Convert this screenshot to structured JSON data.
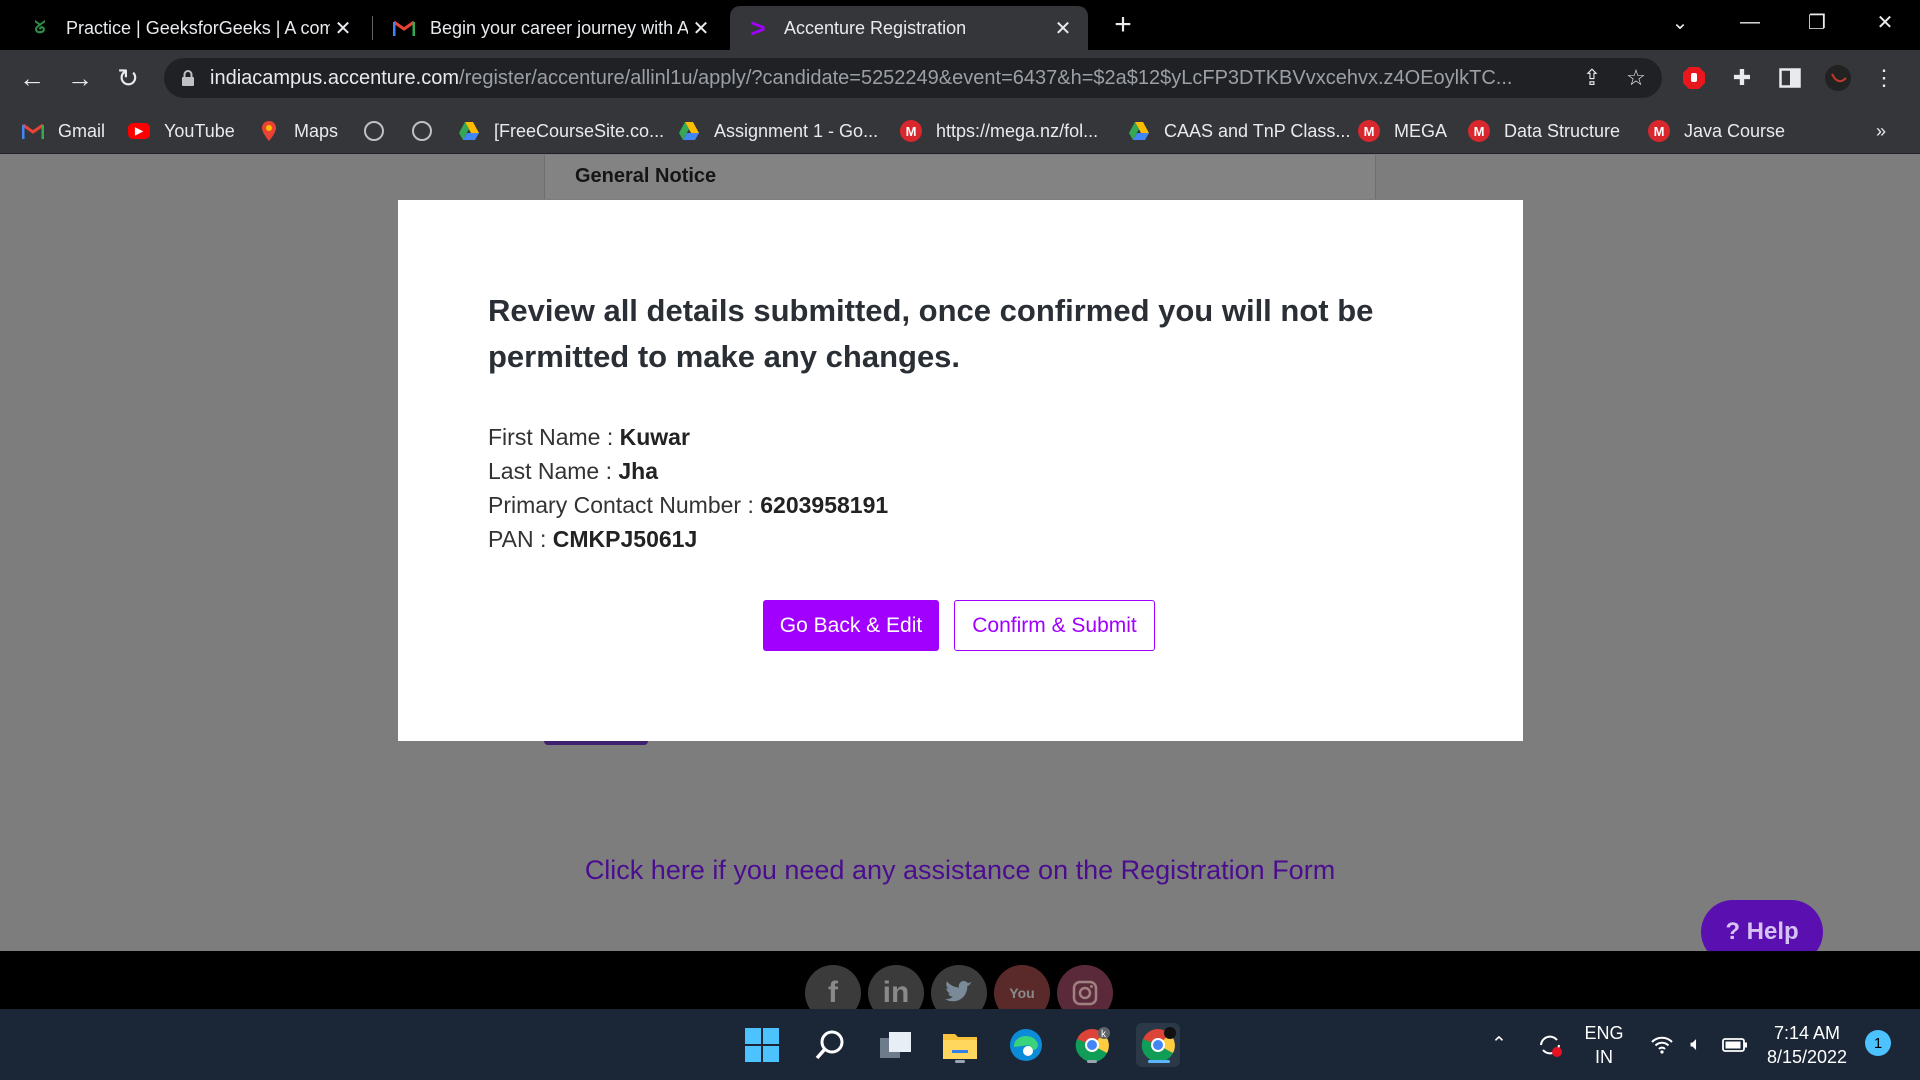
{
  "browser": {
    "tabs": [
      {
        "title": "Practice | GeeksforGeeks | A comp",
        "icon": "gfg-icon"
      },
      {
        "title": "Begin your career journey with A",
        "icon": "gmail-icon"
      },
      {
        "title": "Accenture Registration",
        "icon": "accenture-icon"
      }
    ],
    "address": {
      "host": "indiacampus.accenture.com",
      "path": "/register/accenture/allinl1u/apply/?candidate=5252249&event=6437&h=$2a$12$yLcFP3DTKBVvxcehvx.z4OEoylkTC..."
    },
    "bookmarks": [
      {
        "label": "Gmail",
        "icon": "gmail-icon"
      },
      {
        "label": "YouTube",
        "icon": "youtube-icon"
      },
      {
        "label": "Maps",
        "icon": "maps-icon"
      },
      {
        "label": "",
        "icon": "globe-icon"
      },
      {
        "label": "",
        "icon": "globe-icon"
      },
      {
        "label": "[FreeCourseSite.co...",
        "icon": "drive-icon"
      },
      {
        "label": "Assignment 1 - Go...",
        "icon": "drive-icon"
      },
      {
        "label": "https://mega.nz/fol...",
        "icon": "mega-icon"
      },
      {
        "label": "CAAS and TnP Class...",
        "icon": "drive-icon"
      },
      {
        "label": "MEGA",
        "icon": "mega-icon"
      },
      {
        "label": "Data Structure",
        "icon": "mega-icon"
      },
      {
        "label": "Java Course",
        "icon": "mega-icon"
      }
    ],
    "more_bookmarks": "»"
  },
  "page": {
    "notice_title": "General Notice",
    "assist_link": "Click here if you need any assistance on the Registration Form",
    "help_label": "? Help"
  },
  "modal": {
    "heading": "Review all details submitted, once confirmed you will not be permitted to make any changes.",
    "fields": [
      {
        "label": "First Name : ",
        "value": "Kuwar"
      },
      {
        "label": "Last Name : ",
        "value": "Jha"
      },
      {
        "label": "Primary Contact Number : ",
        "value": "6203958191"
      },
      {
        "label": "PAN : ",
        "value": "CMKPJ5061J"
      }
    ],
    "back_label": "Go Back & Edit",
    "confirm_label": "Confirm & Submit"
  },
  "taskbar": {
    "lang_top": "ENG",
    "lang_bottom": "IN",
    "time": "7:14 AM",
    "date": "8/15/2022",
    "notifications": "1"
  },
  "colors": {
    "accent": "#a100ff",
    "overlay": "#7d7d7d",
    "link": "#4b0d8f"
  }
}
